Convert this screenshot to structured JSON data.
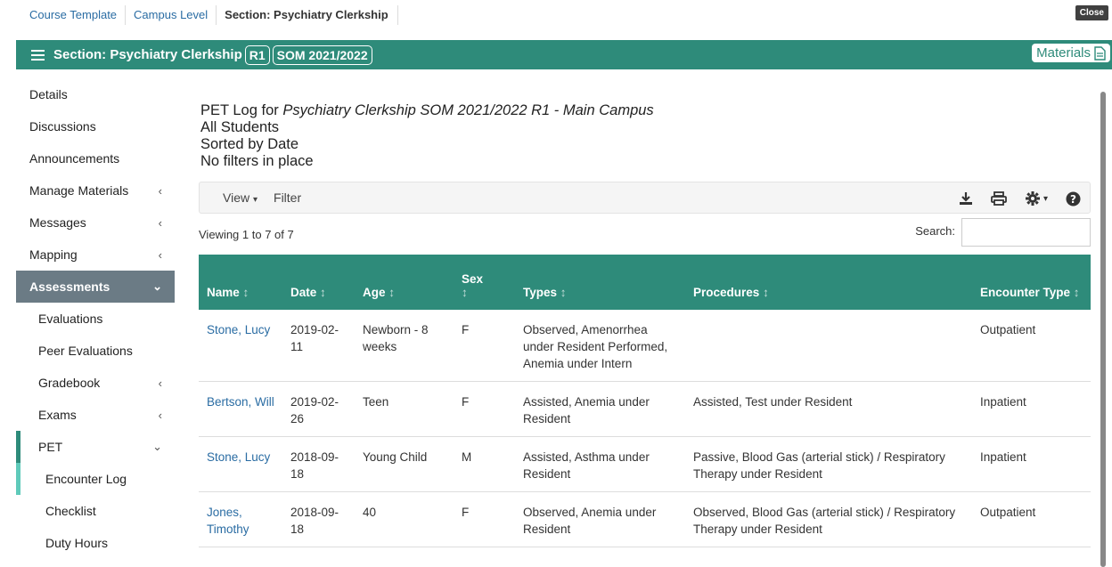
{
  "breadcrumbs": [
    "Course Template",
    "Campus Level",
    "Section: Psychiatry Clerkship"
  ],
  "close_label": "Close",
  "header": {
    "title": "Section: Psychiatry Clerkship",
    "pill1": "R1",
    "pill2": "SOM 2021/2022",
    "materials": "Materials"
  },
  "sidebar": {
    "items": [
      {
        "label": "Details"
      },
      {
        "label": "Discussions"
      },
      {
        "label": "Announcements"
      },
      {
        "label": "Manage Materials",
        "chev": "‹"
      },
      {
        "label": "Messages",
        "chev": "‹"
      },
      {
        "label": "Mapping",
        "chev": "‹"
      },
      {
        "label": "Assessments",
        "chev": "⌄"
      },
      {
        "label": "Evaluations"
      },
      {
        "label": "Peer Evaluations"
      },
      {
        "label": "Gradebook",
        "chev": "‹"
      },
      {
        "label": "Exams",
        "chev": "‹"
      },
      {
        "label": "PET",
        "chev": "⌄"
      },
      {
        "label": "Encounter Log"
      },
      {
        "label": "Checklist"
      },
      {
        "label": "Duty Hours"
      }
    ]
  },
  "main": {
    "heading_prefix": "PET Log for ",
    "heading_course": "Psychiatry Clerkship SOM 2021/2022 R1 - Main Campus",
    "line2": "All Students",
    "line3": "Sorted by Date",
    "line4": "No filters in place",
    "view_label": "View",
    "filter_label": "Filter",
    "viewing": "Viewing 1 to 7 of 7",
    "search_label": "Search:"
  },
  "table": {
    "columns": [
      "Name",
      "Date",
      "Age",
      "Sex",
      "Types",
      "Procedures",
      "Encounter Type"
    ],
    "rows": [
      {
        "name": "Stone, Lucy",
        "date": "2019-02-11",
        "age": "Newborn - 8 weeks",
        "sex": "F",
        "types": "Observed, Amenorrhea under Resident Performed, Anemia under Intern",
        "procedures": "",
        "encounter": "Outpatient"
      },
      {
        "name": "Bertson, Will",
        "date": "2019-02-26",
        "age": "Teen",
        "sex": "F",
        "types": "Assisted, Anemia under Resident",
        "procedures": "Assisted, Test under Resident",
        "encounter": "Inpatient"
      },
      {
        "name": "Stone, Lucy",
        "date": "2018-09-18",
        "age": "Young Child",
        "sex": "M",
        "types": "Assisted, Asthma under Resident",
        "procedures": "Passive, Blood Gas (arterial stick) / Respiratory Therapy under Resident",
        "encounter": "Inpatient"
      },
      {
        "name": "Jones, Timothy",
        "date": "2018-09-18",
        "age": "40",
        "sex": "F",
        "types": "Observed, Anemia under Resident",
        "procedures": "Observed, Blood Gas (arterial stick) / Respiratory Therapy under Resident",
        "encounter": "Outpatient"
      }
    ]
  },
  "colors": {
    "accent": "#2e8b7a",
    "active_nav": "#6b7b85",
    "link": "#2a6ca3"
  }
}
